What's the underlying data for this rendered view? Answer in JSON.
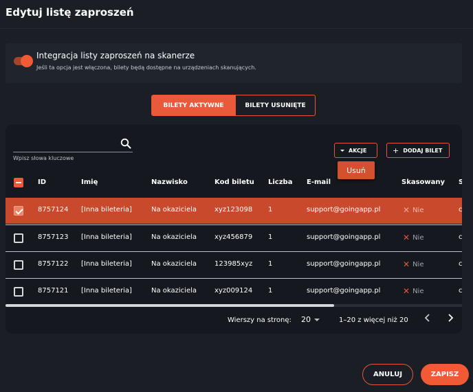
{
  "header": {
    "title": "Edytuj listę zaproszeń"
  },
  "integration": {
    "enabled": true,
    "title": "Integracja listy zaproszeń na skanerze",
    "description": "Jeśli ta opcja jest włączona, bilety będą dostępne na urządzeniach skanujących."
  },
  "tabs": [
    {
      "label": "BILETY AKTYWNE",
      "active": true
    },
    {
      "label": "BILETY USUNIĘTE",
      "active": false
    }
  ],
  "search": {
    "value": "",
    "placeholder": "",
    "hint": "Wpisz słowa kluczowe",
    "icon": "search-icon"
  },
  "toolbar": {
    "actions_label": "AKCJE",
    "add_label": "DODAJ BILET",
    "dropdown_item": "Usuń"
  },
  "table": {
    "headers": [
      "ID",
      "Imię",
      "Nazwisko",
      "Kod biletu",
      "Liczba",
      "E-mail",
      "Skasowany",
      "S"
    ],
    "rows": [
      {
        "selected": true,
        "id": "8757124",
        "name": "[Inna bileteria]",
        "surname": "Na okaziciela",
        "code": "xyz123098",
        "count": "1",
        "email": "support@goingapp.pl",
        "used": "Nie",
        "extra": "c"
      },
      {
        "selected": false,
        "id": "8757123",
        "name": "[Inna bileteria]",
        "surname": "Na okaziciela",
        "code": "xyz456879",
        "count": "1",
        "email": "support@goingapp.pl",
        "used": "Nie",
        "extra": "c"
      },
      {
        "selected": false,
        "id": "8757122",
        "name": "[Inna bileteria]",
        "surname": "Na okaziciela",
        "code": "123985xyz",
        "count": "1",
        "email": "support@goingapp.pl",
        "used": "Nie",
        "extra": "c"
      },
      {
        "selected": false,
        "id": "8757121",
        "name": "[Inna bileteria]",
        "surname": "Na okaziciela",
        "code": "xyz009124",
        "count": "1",
        "email": "support@goingapp.pl",
        "used": "Nie",
        "extra": "c"
      }
    ],
    "horizontal_scroll_fraction": 0.72
  },
  "pagination": {
    "rows_per_page_label": "Wierszy na stronę:",
    "rows_per_page": "20",
    "range": "1–20 z więcej niż 20"
  },
  "footer": {
    "cancel_label": "ANULUJ",
    "save_label": "ZAPISZ"
  },
  "colors": {
    "accent": "#f05a35",
    "selected_row": "#c8492c",
    "background": "#1b1e25",
    "card": "#15181e"
  }
}
